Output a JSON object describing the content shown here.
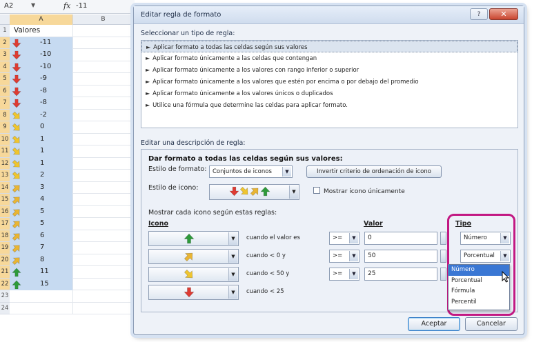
{
  "formula_bar": {
    "cell_ref": "A2",
    "fx": "fx",
    "value": "-11"
  },
  "columns": [
    "A",
    "B"
  ],
  "sheet": {
    "header": "Valores",
    "row_numbers": [
      "1",
      "2",
      "3",
      "4",
      "5",
      "6",
      "7",
      "8",
      "9",
      "10",
      "11",
      "12",
      "13",
      "14",
      "15",
      "16",
      "17",
      "18",
      "19",
      "20",
      "21",
      "22",
      "23",
      "24"
    ],
    "rows": [
      {
        "icon": "down",
        "value": "-11"
      },
      {
        "icon": "down",
        "value": "-10"
      },
      {
        "icon": "down",
        "value": "-10"
      },
      {
        "icon": "down",
        "value": "-9"
      },
      {
        "icon": "down",
        "value": "-8"
      },
      {
        "icon": "down",
        "value": "-8"
      },
      {
        "icon": "down-right",
        "value": "-2"
      },
      {
        "icon": "down-right",
        "value": "0"
      },
      {
        "icon": "down-right",
        "value": "1"
      },
      {
        "icon": "down-right",
        "value": "1"
      },
      {
        "icon": "down-right",
        "value": "1"
      },
      {
        "icon": "down-right",
        "value": "2"
      },
      {
        "icon": "up-right",
        "value": "3"
      },
      {
        "icon": "up-right",
        "value": "4"
      },
      {
        "icon": "up-right",
        "value": "5"
      },
      {
        "icon": "up-right",
        "value": "5"
      },
      {
        "icon": "up-right",
        "value": "6"
      },
      {
        "icon": "up-right",
        "value": "7"
      },
      {
        "icon": "up-right",
        "value": "8"
      },
      {
        "icon": "up",
        "value": "11"
      },
      {
        "icon": "up",
        "value": "15"
      }
    ]
  },
  "dialog": {
    "title": "Editar regla de formato",
    "help": "?",
    "close": "✕",
    "rule_type_label": "Seleccionar un tipo de regla:",
    "rule_types": [
      "Aplicar formato a todas las celdas según sus valores",
      "Aplicar formato únicamente a las celdas que contengan",
      "Aplicar formato únicamente a los valores con rango inferior o superior",
      "Aplicar formato únicamente a los valores que estén por encima o por debajo del promedio",
      "Aplicar formato únicamente a los valores únicos o duplicados",
      "Utilice una fórmula que determine las celdas para aplicar formato."
    ],
    "rule_desc_label": "Editar una descripción de regla:",
    "desc_title": "Dar formato a todas las celdas según sus valores:",
    "format_style_label": "Estilo de formato:",
    "format_style_value": "Conjuntos de iconos",
    "reverse_label": "Invertir criterio de ordenación de icono",
    "icon_style_label": "Estilo de icono:",
    "show_icon_only": "Mostrar icono únicamente",
    "show_rule_label": "Mostrar cada icono según estas reglas:",
    "col_icon": "Icono",
    "col_value": "Valor",
    "col_type": "Tipo",
    "rules": [
      {
        "icon": "up",
        "condition": "cuando el valor es",
        "op": ">=",
        "value": "0",
        "type": "Número"
      },
      {
        "icon": "up-right",
        "condition": "cuando < 0 y",
        "op": ">=",
        "value": "50",
        "type": "Porcentual"
      },
      {
        "icon": "down-right",
        "condition": "cuando < 50 y",
        "op": ">=",
        "value": "25",
        "type": ""
      },
      {
        "icon": "down",
        "condition": "cuando < 25",
        "op": "",
        "value": "",
        "type": ""
      }
    ],
    "type_options": [
      "Número",
      "Porcentual",
      "Fórmula",
      "Percentil"
    ],
    "ok": "Aceptar",
    "cancel": "Cancelar"
  },
  "colors": {
    "arrow_up": "#2e9a3a",
    "arrow_up_right": "#e9b534",
    "arrow_down_right": "#efc52f",
    "arrow_down": "#de3b33",
    "selection": "#c6daf1",
    "highlight_frame": "#c21883"
  }
}
